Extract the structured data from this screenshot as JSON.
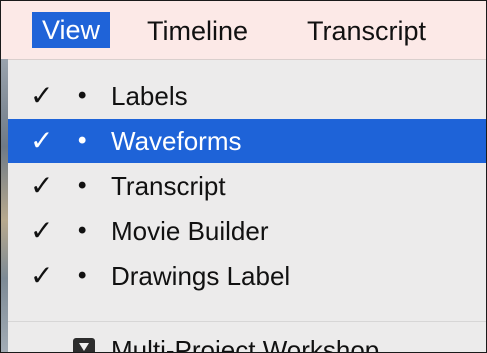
{
  "menubar": {
    "items": [
      {
        "label": "View",
        "active": true
      },
      {
        "label": "Timeline",
        "active": false
      },
      {
        "label": "Transcript",
        "active": false
      }
    ]
  },
  "view_menu": {
    "items": [
      {
        "check": "✓",
        "bullet": "•",
        "label": "Labels",
        "checked": true,
        "highlighted": false
      },
      {
        "check": "✓",
        "bullet": "•",
        "label": "Waveforms",
        "checked": true,
        "highlighted": true
      },
      {
        "check": "✓",
        "bullet": "•",
        "label": "Transcript",
        "checked": true,
        "highlighted": false
      },
      {
        "check": "✓",
        "bullet": "•",
        "label": "Movie Builder",
        "checked": true,
        "highlighted": false
      },
      {
        "check": "✓",
        "bullet": "•",
        "label": "Drawings Label",
        "checked": true,
        "highlighted": false
      }
    ],
    "partial_item": {
      "label": "Multi-Project Workshop",
      "icon": "app-icon"
    }
  },
  "colors": {
    "menubar_bg": "#fce9e7",
    "menu_bg": "#ecebeb",
    "highlight": "#1e63d8",
    "text": "#111111"
  }
}
